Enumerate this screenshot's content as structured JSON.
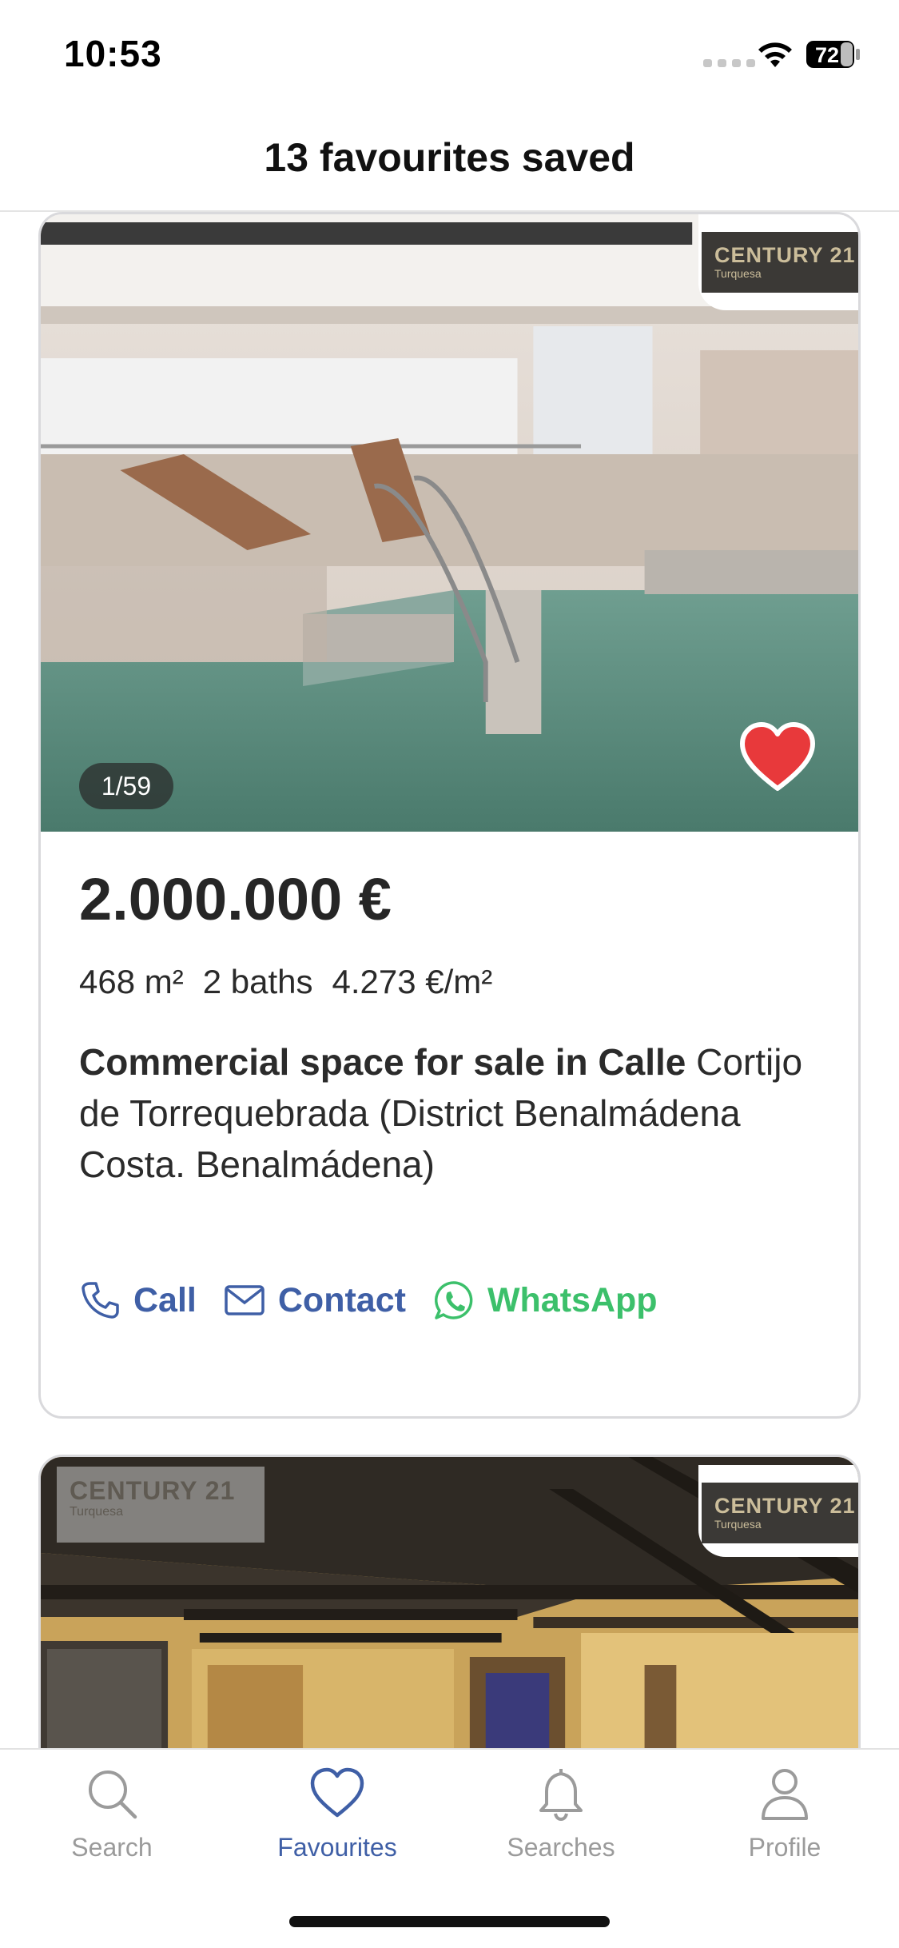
{
  "status_bar": {
    "time": "10:53",
    "battery": "72",
    "icons": [
      "signal-icon",
      "wifi-icon",
      "battery-icon"
    ]
  },
  "header": {
    "title": "13 favourites saved"
  },
  "listings": [
    {
      "photo_counter": "1/59",
      "agency": {
        "name": "CENTURY 21",
        "office": "Turquesa"
      },
      "favourite": true,
      "price": "2.000.000 €",
      "features": [
        "468 m²",
        "2 baths",
        "4.273 €/m²"
      ],
      "title_bold": "Commercial space for sale in Calle",
      "title_rest": "Cortijo de Torrequebrada (District Benalmádena Costa. Benalmádena)",
      "actions": {
        "call": "Call",
        "contact": "Contact",
        "whatsapp": "WhatsApp"
      }
    },
    {
      "agency": {
        "name": "CENTURY 21",
        "office": "Turquesa"
      },
      "watermark": {
        "name": "CENTURY 21",
        "office": "Turquesa"
      }
    }
  ],
  "tab_bar": {
    "tabs": [
      {
        "label": "Search",
        "icon": "search-icon",
        "active": false
      },
      {
        "label": "Favourites",
        "icon": "heart-icon",
        "active": true
      },
      {
        "label": "Searches",
        "icon": "bell-icon",
        "active": false
      },
      {
        "label": "Profile",
        "icon": "person-icon",
        "active": false
      }
    ]
  },
  "colors": {
    "accent": "#3f5fa6",
    "whatsapp": "#3cc06b",
    "favourite": "#e8393b",
    "inactive_tab": "#9b9b9b"
  }
}
